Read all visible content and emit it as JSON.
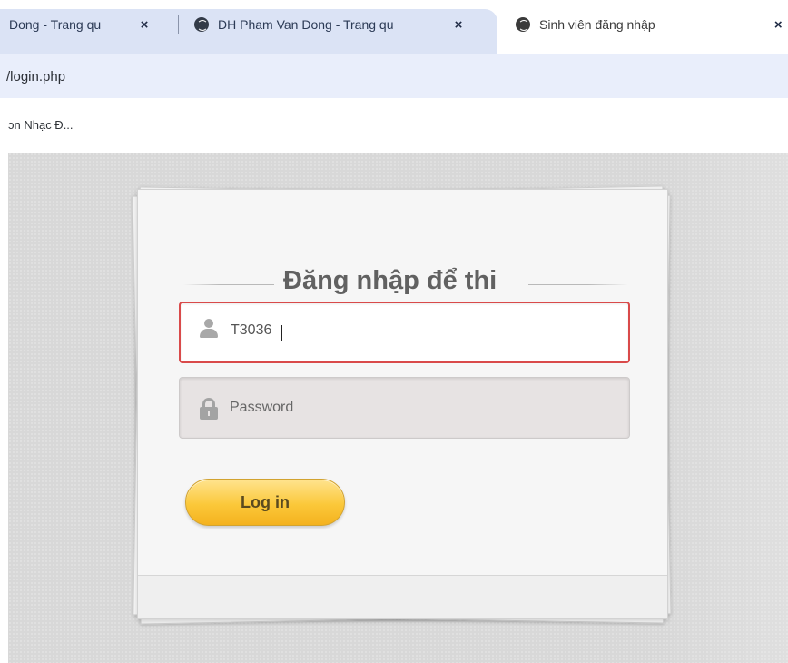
{
  "browser": {
    "tabs": [
      {
        "title": "Dong - Trang qu",
        "close": "×"
      },
      {
        "title": "DH Pham Van Dong - Trang qu",
        "close": "×"
      },
      {
        "title": "Sinh viên đăng nhập",
        "close": "×"
      }
    ],
    "url": "/login.php",
    "bookmark": "ɔn Nhạc Đ..."
  },
  "login": {
    "heading": "Đăng nhập để thi",
    "username_value": "T3036",
    "password_placeholder": "Password",
    "button_label": "Log in"
  },
  "colors": {
    "tabstrip": "#dbe3f5",
    "page_background": "#d8d8d8",
    "field_error_border": "#d94a4a",
    "button_fill": "#fbc83a"
  },
  "icons": [
    "globe-icon",
    "close-icon",
    "user-icon",
    "lock-icon"
  ]
}
